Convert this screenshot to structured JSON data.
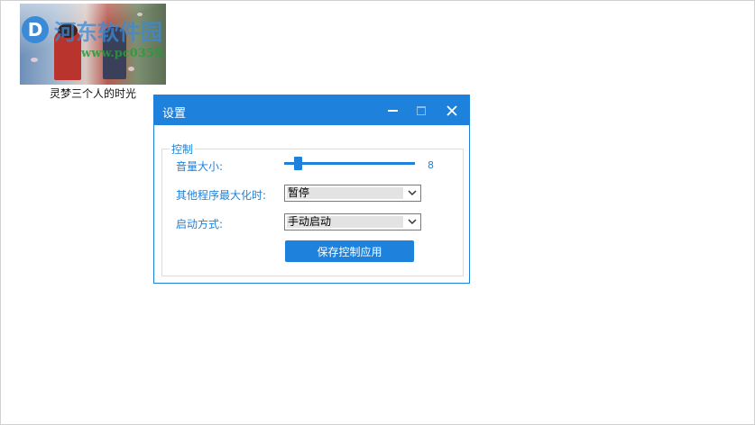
{
  "thumbnail": {
    "caption": "灵梦三个人的时光",
    "watermark_title": "河东软件园",
    "watermark_url": "www.pc0359.cn"
  },
  "dialog": {
    "title": "设置",
    "group_label": "控制",
    "volume": {
      "label": "音量大小:",
      "value": "8",
      "level_fraction": 0.08
    },
    "maximize": {
      "label": "其他程序最大化时:",
      "selected": "暂停"
    },
    "startup": {
      "label": "启动方式:",
      "selected": "手动启动"
    },
    "apply_button": "保存控制应用"
  },
  "colors": {
    "accent": "#1e82dc",
    "select_fill": "#e3e3e3",
    "border": "#dcdcdc"
  },
  "icons": {
    "minimize": "minimize-icon",
    "maximize": "maximize-icon",
    "close": "close-icon",
    "dropdown": "chevron-down-icon"
  }
}
